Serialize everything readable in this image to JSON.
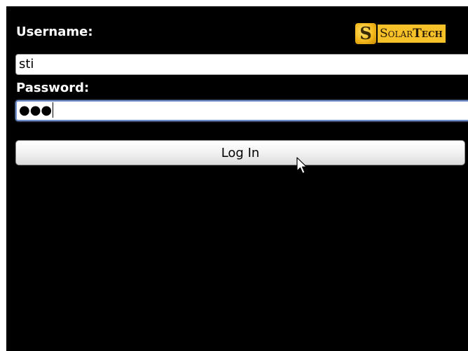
{
  "brand": {
    "mark": "S",
    "name_part1": "Solar",
    "name_part2": "Tech",
    "colors": {
      "mark": "#f4b81c",
      "background": "#f7c12a"
    }
  },
  "form": {
    "username_label": "Username:",
    "username_value": "sti",
    "password_label": "Password:",
    "password_masked": "●●●",
    "login_label": "Log In"
  },
  "icons": {
    "pointer": "mouse-pointer-icon"
  },
  "colors": {
    "screen_background": "#000000",
    "label_text": "#ffffff",
    "focus_border": "#6f8fcc"
  }
}
